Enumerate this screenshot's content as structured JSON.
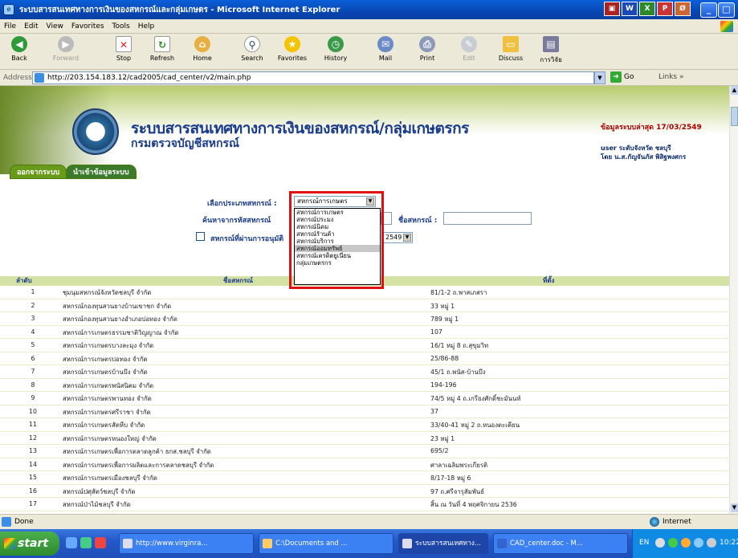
{
  "window": {
    "title": "ระบบสารสนเทศทางการเงินของสหกรณ์และกลุ่มเกษตร - Microsoft Internet Explorer"
  },
  "menu": [
    "File",
    "Edit",
    "View",
    "Favorites",
    "Tools",
    "Help"
  ],
  "toolbar": {
    "back": "Back",
    "forward": "Forward",
    "stop": "Stop",
    "refresh": "Refresh",
    "home": "Home",
    "search": "Search",
    "favorites": "Favorites",
    "history": "History",
    "mail": "Mail",
    "print": "Print",
    "edit": "Edit",
    "discuss": "Discuss",
    "research": "การวิจัย"
  },
  "address": {
    "label": "Address",
    "url": "http://203.154.183.12/cad2005/cad_center/v2/main.php",
    "go": "Go",
    "links": "Links"
  },
  "banner": {
    "title": "ระบบสารสนเทศทางการเงินของสหกรณ์/กลุ่มเกษตรกร",
    "subtitle": "กรมตรวจบัญชีสหกรณ์",
    "update": "ข้อมูลระบบล่าสุด 17/03/2549",
    "user_line1": "user ระดับจังหวัด ชลบุรี",
    "user_line2": "โดย น.ส.กัญจันภัส พิสิฐพงศกร"
  },
  "nav": {
    "logout": "ออกจากระบบ",
    "import": "นำเข้าข้อมูลระบบ"
  },
  "form": {
    "type_label": "เลือกประเภทสหกรณ์ :",
    "type_value": "สหกรณ์การเกษตร",
    "code_label": "ค้นหาจากรหัสสหกรณ์",
    "name_label": "ชื่อสหกรณ์ :",
    "audit_label": "สหกรณ์ที่ผ่านการอนุมัติ",
    "year_value": "2549"
  },
  "dropdown_options": [
    "สหกรณ์การเกษตร",
    "สหกรณ์ประมง",
    "สหกรณ์นิคม",
    "สหกรณ์ร้านค้า",
    "สหกรณ์บริการ",
    "สหกรณ์ออมทรัพย์",
    "สหกรณ์เครดิตยูเนี่ยน",
    "กลุ่มเกษตรกร"
  ],
  "table": {
    "headers": {
      "no": "ลำดับ",
      "name": "ชื่อสหกรณ์",
      "addr": "ที่ตั้ง"
    },
    "rows": [
      {
        "no": "1",
        "name": "ชุมนุมสหกรณ์จังหวัดชลบุรี จำกัด",
        "addr": "81/1-2 ถ.พาสเภสรา"
      },
      {
        "no": "2",
        "name": "สหกรณ์กองทุนสวนยางบ้านเขาชก จำกัด",
        "addr": "33 หมู่ 1"
      },
      {
        "no": "3",
        "name": "สหกรณ์กองทุนสวนยางอำเภอบ่อทอง จำกัด",
        "addr": "789 หมู่ 1"
      },
      {
        "no": "4",
        "name": "สหกรณ์การเกษตรธรรมชาติวิญญาณ จำกัด",
        "addr": "107"
      },
      {
        "no": "5",
        "name": "สหกรณ์การเกษตรบางละมุง จำกัด",
        "addr": "16/1 หมู่ 8 ถ.สุขุมวิท"
      },
      {
        "no": "6",
        "name": "สหกรณ์การเกษตรบ่อทอง จำกัด",
        "addr": "25/86-88"
      },
      {
        "no": "7",
        "name": "สหกรณ์การเกษตรบ้านบึง จำกัด",
        "addr": "45/1 ถ.พนัส-บ้านบึง"
      },
      {
        "no": "8",
        "name": "สหกรณ์การเกษตรพนัสนิคม จำกัด",
        "addr": "194-196"
      },
      {
        "no": "9",
        "name": "สหกรณ์การเกษตรพานทอง จำกัด",
        "addr": "74/5 หมู่ 4 ถ.เกรียงศักดิ์ชะมันนท์"
      },
      {
        "no": "10",
        "name": "สหกรณ์การเกษตรศรีราชา จำกัด",
        "addr": "37"
      },
      {
        "no": "11",
        "name": "สหกรณ์การเกษตรสัตหีบ จำกัด",
        "addr": "33/40-41 หมู่ 2 ถ.หนองตะเคียน"
      },
      {
        "no": "12",
        "name": "สหกรณ์การเกษตรหนองใหญ่ จำกัด",
        "addr": "23 หมู่ 1"
      },
      {
        "no": "13",
        "name": "สหกรณ์การเกษตรเพื่อการตลาดลูกค้า ธกส.ชลบุรี จำกัด",
        "addr": "695/2"
      },
      {
        "no": "14",
        "name": "สหกรณ์การเกษตรเพื่อการผลิตและการตลาดชลบุรี จำกัด",
        "addr": "ศาลาเฉลิมพระเกียรติ"
      },
      {
        "no": "15",
        "name": "สหกรณ์การเกษตรเมืองชลบุรี จำกัด",
        "addr": "8/17-18 หมู่ 6"
      },
      {
        "no": "16",
        "name": "สหกรณ์ปศุสัตว์ชลบุรี จำกัด",
        "addr": "97 ถ.ศรีจารุสัมพันธ์"
      },
      {
        "no": "17",
        "name": "สหกรณ์ป่าไม้ชลบุรี จำกัด",
        "addr": "สิ้น ณ วันที่ 4 พฤศจิกายน 2536"
      }
    ]
  },
  "status": {
    "left": "Done",
    "zone": "Internet"
  },
  "taskbar": {
    "start": "start",
    "tasks": [
      "http://www.virginra...",
      "C:\\Documents and ...",
      "ระบบสารสนเทศทาง...",
      "CAD_center.doc - M..."
    ],
    "lang": "EN",
    "clock": "10:22"
  }
}
